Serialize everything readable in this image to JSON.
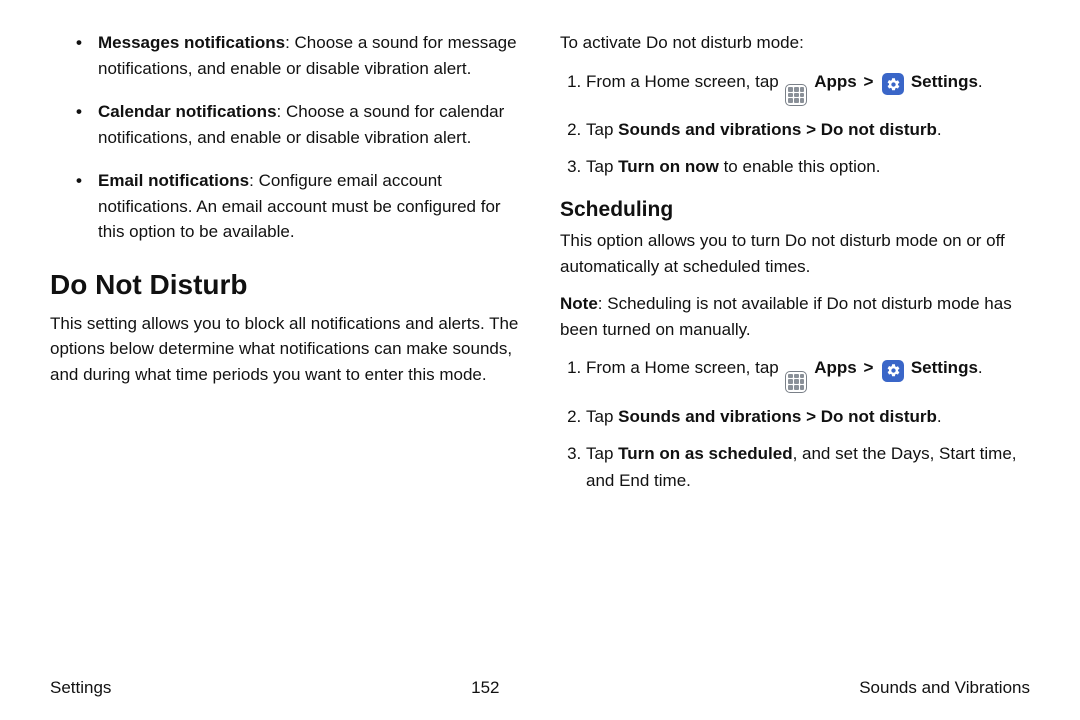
{
  "left": {
    "bullets": [
      {
        "label": "Messages notifications",
        "desc": ": Choose a sound for message notifications, and enable or disable vibration alert."
      },
      {
        "label": "Calendar notifications",
        "desc": ": Choose a sound for calendar notifications, and enable or disable vibration alert."
      },
      {
        "label": "Email notifications",
        "desc": ": Configure email account notifications. An email account must be configured for this option to be available."
      }
    ],
    "h1": "Do Not Disturb",
    "p1": "This setting allows you to block all notifications and alerts. The options below determine what notifications can make sounds, and during what time periods you want to enter this mode."
  },
  "right": {
    "p1": "To activate Do not disturb mode:",
    "steps1": {
      "s1_a": "From a Home screen, tap ",
      "apps": "Apps",
      "settings": "Settings",
      "s1_b": ".",
      "s2_a": "Tap ",
      "s2_b": "Sounds and vibrations > Do not disturb",
      "s2_c": ".",
      "s3_a": "Tap ",
      "s3_b": "Turn on now",
      "s3_c": " to enable this option."
    },
    "h2": "Scheduling",
    "p2": "This option allows you to turn Do not disturb mode on or off automatically at scheduled times.",
    "note_label": "Note",
    "note_body": ": Scheduling is not available if Do not disturb mode has been turned on manually.",
    "steps2": {
      "s1_a": "From a Home screen, tap ",
      "apps": "Apps",
      "settings": "Settings",
      "s1_b": ".",
      "s2_a": "Tap ",
      "s2_b": "Sounds and vibrations > Do not disturb",
      "s2_c": ".",
      "s3_a": "Tap ",
      "s3_b": "Turn on as scheduled",
      "s3_c": ", and set the Days, Start time, and End time."
    }
  },
  "footer": {
    "left": "Settings",
    "center": "152",
    "right": "Sounds and Vibrations"
  },
  "glyphs": {
    "gt": ">"
  }
}
